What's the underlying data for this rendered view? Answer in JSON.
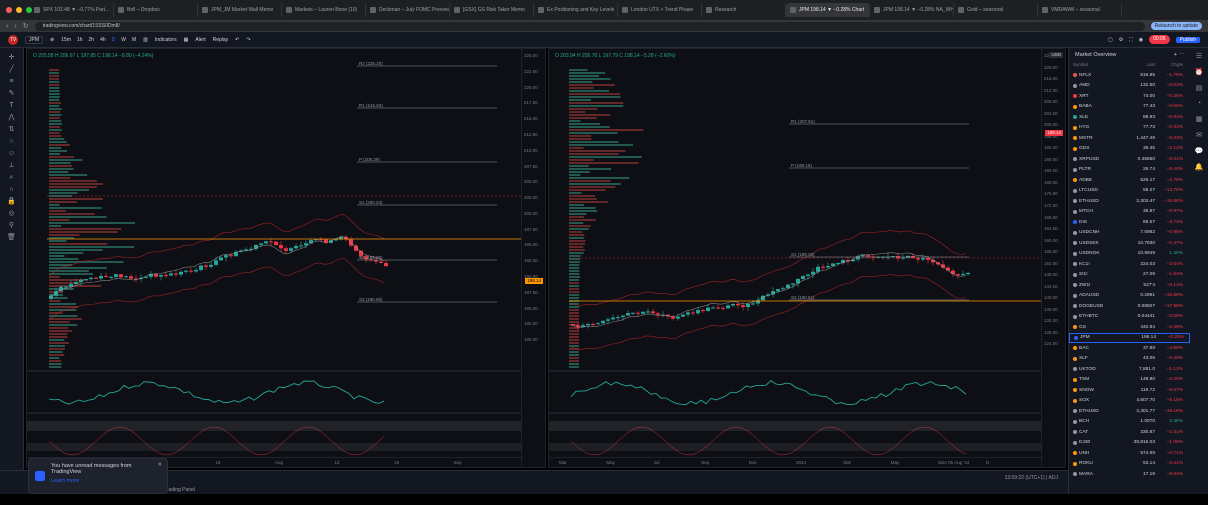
{
  "browser": {
    "tabs": [
      "SPX 102.48 ▼ −0.77% Part…",
      "Bell – Dropbox",
      "JPM_JM Market Wall Memo",
      "Markets – Lauren Bone (10)",
      "Deckman – July FOMC Preview",
      "[GSX] GS Risk Taker Memo",
      "Ex Positioning and Key Levels",
      "London UTX + Trend Phase",
      "Research",
      "JPM 198.14 ▼ −0.28% Chart",
      "JPM 198.14 ▼ −0.28% NA_WH",
      "Gold – seasonal",
      "VMDAWM – seasonal"
    ],
    "active_tab_index": 9,
    "url": "tradingview.com/chart/1SSS0Dm8/",
    "relaunch_label": "Relaunch to update"
  },
  "toolbar": {
    "symbol": "JPM",
    "intervals": [
      "15m",
      "1h",
      "2h",
      "4h",
      "D",
      "W",
      "M"
    ],
    "indicators_label": "Indicators",
    "alert_label": "Alert",
    "replay_label": "Replay",
    "record_label": "00:06",
    "publish_label": "Publish"
  },
  "left_chart": {
    "legend": "O 205.58 H 206.67 L 197.85 C 198.14 −8.80 (−4.24%)",
    "price_ticks": [
      "225.00",
      "222.50",
      "220.00",
      "217.50",
      "215.00",
      "212.50",
      "210.00",
      "207.50",
      "205.00",
      "202.50",
      "200.00",
      "197.50",
      "195.00",
      "192.50",
      "190.00",
      "187.50",
      "185.00",
      "182.50",
      "180.00"
    ],
    "time_ticks": [
      "Jun",
      "17",
      "Jul",
      "15",
      "Aug",
      "12",
      "19",
      "Sep"
    ],
    "levels": [
      "R2 (225.20)",
      "R1 (215.63)",
      "P (205.29)",
      "S1 (200.24)",
      "S2 (195.26)",
      "S3 (190.05)"
    ],
    "price_badge": "198.14",
    "osc_ticks": [
      "20.00",
      "0.00",
      "−20.00"
    ],
    "stoch_ticks": [
      "80.00",
      "40.00",
      "20.00"
    ]
  },
  "right_chart": {
    "legend": "O 203.94 H 205.76 L 197.79 C 198.14 −5.28 (−2.60%)",
    "price_ticks": [
      "224.00",
      "220.00",
      "216.00",
      "212.00",
      "208.00",
      "204.00",
      "200.00",
      "196.00",
      "192.00",
      "188.00",
      "184.00",
      "180.00",
      "176.00",
      "172.00",
      "168.00",
      "164.00",
      "160.00",
      "156.00",
      "152.00",
      "148.00",
      "144.00",
      "140.00",
      "136.00",
      "132.00",
      "128.00",
      "124.00"
    ],
    "time_ticks": [
      "Mar",
      "May",
      "Jul",
      "Sep",
      "Nov",
      "2024",
      "Mar",
      "May",
      "Mon 05 Aug '24",
      "N"
    ],
    "levels": [
      "R1 (207.51)",
      "P (190.15)",
      "S1 (168.38)",
      "S2 (160.51)"
    ],
    "price_badge": "198.14",
    "currency": "USD"
  },
  "watchlist": {
    "title": "Market Overview",
    "columns": [
      "Symbol",
      "Last",
      "Chg%"
    ],
    "rows": [
      {
        "symbol": "NFLX",
        "last": "616.85",
        "chg": "−1.78%",
        "dir": "dn",
        "color": "#ef5350"
      },
      {
        "symbol": "AMD",
        "last": "132.50",
        "chg": "−0.03%",
        "dir": "dn",
        "color": "#9598a1"
      },
      {
        "symbol": "XRT",
        "last": "74.00",
        "chg": "−0.26%",
        "dir": "dn",
        "color": "#f23645"
      },
      {
        "symbol": "BABA",
        "last": "77.43",
        "chg": "−0.66%",
        "dir": "dn",
        "color": "#ff9800"
      },
      {
        "symbol": "XLE",
        "last": "88.93",
        "chg": "−0.94%",
        "dir": "dn",
        "color": "#26a69a"
      },
      {
        "symbol": "HYG",
        "last": "77.73",
        "chg": "−0.33%",
        "dir": "dn",
        "color": "#ff9800"
      },
      {
        "symbol": "MSTR",
        "last": "1,447.49",
        "chg": "−5.23%",
        "dir": "dn",
        "color": "#ff9800"
      },
      {
        "symbol": "GDX",
        "last": "36.45",
        "chg": "−2.12%",
        "dir": "dn",
        "color": "#ff9800"
      },
      {
        "symbol": "XRPUSD",
        "last": "0.45650",
        "chg": "−5.01%",
        "dir": "dn",
        "color": "#9598a1"
      },
      {
        "symbol": "PLTR",
        "last": "26.74",
        "chg": "−5.48%",
        "dir": "dn",
        "color": "#9598a1"
      },
      {
        "symbol": "ADBE",
        "last": "526.17",
        "chg": "−2.78%",
        "dir": "dn",
        "color": "#ff9800"
      },
      {
        "symbol": "LTCUSD",
        "last": "58.27",
        "chg": "−14.79%",
        "dir": "dn",
        "color": "#9598a1"
      },
      {
        "symbol": "ETHUSD",
        "last": "2,303.47",
        "chg": "−19.88%",
        "dir": "dn",
        "color": "#9598a1"
      },
      {
        "symbol": "MTCH",
        "last": "36.87",
        "chg": "−0.97%",
        "dir": "dn",
        "color": "#9598a1"
      },
      {
        "symbol": "DIS",
        "last": "86.57",
        "chg": "−3.74%",
        "dir": "dn",
        "color": "#2962ff"
      },
      {
        "symbol": "USDCNH",
        "last": "7.0982",
        "chg": "−0.98%",
        "dir": "dn",
        "color": "#9598a1"
      },
      {
        "symbol": "USDSEK",
        "last": "10.7830",
        "chg": "−0.47%",
        "dir": "dn",
        "color": "#9598a1"
      },
      {
        "symbol": "USDNOK",
        "last": "10.9949",
        "chg": "1.30%",
        "dir": "up",
        "color": "#9598a1"
      },
      {
        "symbol": "KC1!",
        "last": "224.03",
        "chg": "−2.54%",
        "dir": "dn",
        "color": "#9598a1"
      },
      {
        "symbol": "SI1!",
        "last": "27.09",
        "chg": "−1.64%",
        "dir": "dn",
        "color": "#9598a1"
      },
      {
        "symbol": "ZW1!",
        "last": "527'4",
        "chg": "−0.14%",
        "dir": "dn",
        "color": "#9598a1"
      },
      {
        "symbol": "ADAUSD",
        "last": "0.2891",
        "chg": "−15.88%",
        "dir": "dn",
        "color": "#9598a1"
      },
      {
        "symbol": "DOGEUSD",
        "last": "0.08927",
        "chg": "−17.98%",
        "dir": "dn",
        "color": "#9598a1"
      },
      {
        "symbol": "ETHBTC",
        "last": "0.04441",
        "chg": "−3.06%",
        "dir": "dn",
        "color": "#9598a1"
      },
      {
        "symbol": "GS",
        "last": "440.84",
        "chg": "−5.48%",
        "dir": "dn",
        "color": "#ff9800"
      },
      {
        "symbol": "JPM",
        "last": "198.14",
        "chg": "−0.28%",
        "dir": "dn",
        "color": "#2962ff",
        "selected": true
      },
      {
        "symbol": "BAC",
        "last": "37.88",
        "chg": "−4.88%",
        "dir": "dn",
        "color": "#ff9800"
      },
      {
        "symbol": "XLF",
        "last": "43.06",
        "chg": "−2.40%",
        "dir": "dn",
        "color": "#ff9800"
      },
      {
        "symbol": "UKTOD",
        "last": "7,881.0",
        "chg": "−1.12%",
        "dir": "dn",
        "color": "#9598a1"
      },
      {
        "symbol": "TSM",
        "last": "149.80",
        "chg": "−3.30%",
        "dir": "dn",
        "color": "#ff9800"
      },
      {
        "symbol": "SNOW",
        "last": "119.72",
        "chg": "−5.67%",
        "dir": "dn",
        "color": "#ff9800"
      },
      {
        "symbol": "SOX",
        "last": "4,607.70",
        "chg": "−5.18%",
        "dir": "dn",
        "color": "#ff9800"
      },
      {
        "symbol": "ETHUSD",
        "last": "2,301.77",
        "chg": "−19.18%",
        "dir": "dn",
        "color": "#9598a1"
      },
      {
        "symbol": "BCH",
        "last": "1.0070",
        "chg": "2.48%",
        "dir": "up",
        "color": "#9598a1"
      },
      {
        "symbol": "CAT",
        "last": "330.87",
        "chg": "−2.31%",
        "dir": "dn",
        "color": "#9598a1"
      },
      {
        "symbol": "DJ30",
        "last": "38,816.03",
        "chg": "−1.08%",
        "dir": "dn",
        "color": "#9598a1"
      },
      {
        "symbol": "UNH",
        "last": "574.68",
        "chg": "−0.71%",
        "dir": "dn",
        "color": "#ff9800"
      },
      {
        "symbol": "ROKU",
        "last": "53.14",
        "chg": "−3.41%",
        "dir": "dn",
        "color": "#ff9800"
      },
      {
        "symbol": "MARA",
        "last": "17.19",
        "chg": "−9.84%",
        "dir": "dn",
        "color": "#9598a1"
      }
    ],
    "footer_symbol": "JPM"
  },
  "toast": {
    "title": "You have unread messages from TradingView",
    "link": "Learn more"
  },
  "bottom": {
    "panel_label": "Trading Panel",
    "clock": "13:09:22 (UTC+1)",
    "adj": "ADJ"
  },
  "colors": {
    "up": "#26a69a",
    "down": "#f23645",
    "background": "#0d0f14",
    "accent": "#2962ff",
    "pivot": "#ff9800"
  }
}
